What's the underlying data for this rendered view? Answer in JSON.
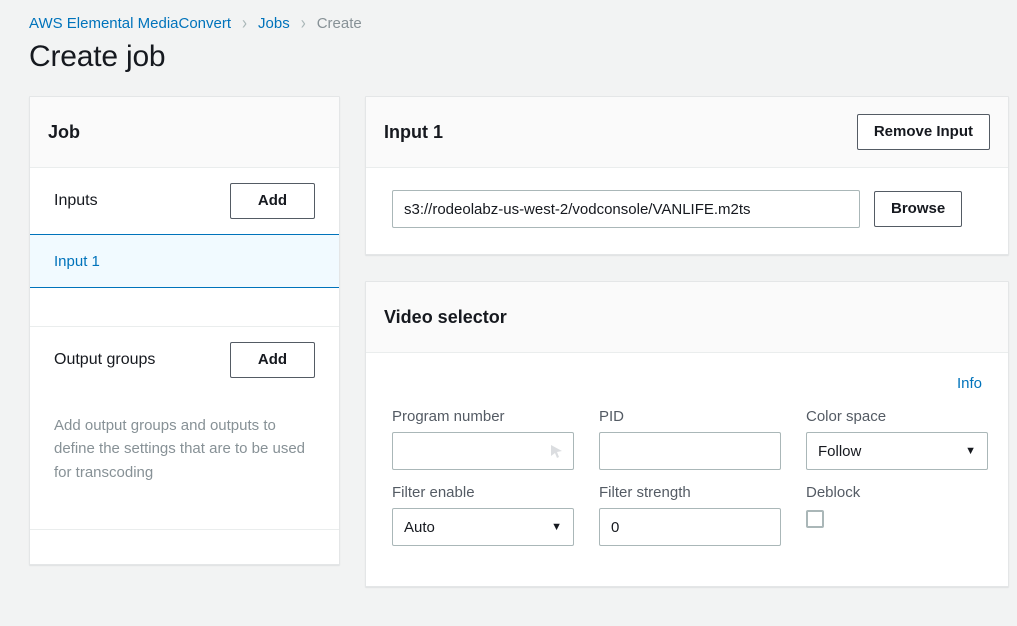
{
  "breadcrumb": {
    "items": [
      {
        "label": "AWS Elemental MediaConvert",
        "type": "link"
      },
      {
        "label": "Jobs",
        "type": "link"
      },
      {
        "label": "Create",
        "type": "current"
      }
    ],
    "separator": "›"
  },
  "page": {
    "title": "Create job"
  },
  "colors": {
    "link": "#0073bb",
    "page_background": "#f2f3f3",
    "panel_header_background": "#fafafa",
    "selected_item_background": "#f1faff",
    "muted_text": "#879196",
    "label_text": "#545b64"
  },
  "sidebar": {
    "title": "Job",
    "inputs": {
      "label": "Inputs",
      "add_label": "Add",
      "items": [
        {
          "label": "Input 1",
          "selected": true
        }
      ]
    },
    "output_groups": {
      "label": "Output groups",
      "add_label": "Add",
      "empty_text": "Add output groups and outputs to define the settings that are to be used for transcoding"
    }
  },
  "input_panel": {
    "title": "Input 1",
    "remove_label": "Remove Input",
    "file_input": {
      "value": "s3://rodeolabz-us-west-2/vodconsole/VANLIFE.m2ts",
      "placeholder": "s3://bucket/path"
    },
    "browse_label": "Browse"
  },
  "video_selector": {
    "title": "Video selector",
    "info_label": "Info",
    "fields": [
      {
        "name": "program-number",
        "label": "Program number",
        "kind": "text",
        "value": "",
        "placeholder": ""
      },
      {
        "name": "pid",
        "label": "PID",
        "kind": "text",
        "value": "",
        "placeholder": ""
      },
      {
        "name": "color-space",
        "label": "Color space",
        "kind": "select",
        "value": "Follow",
        "caret": "▼"
      },
      {
        "name": "filter-enable",
        "label": "Filter enable",
        "kind": "select",
        "value": "Auto",
        "caret": "▼"
      },
      {
        "name": "filter-strength",
        "label": "Filter strength",
        "kind": "text",
        "value": "0",
        "placeholder": ""
      },
      {
        "name": "deblock",
        "label": "Deblock",
        "kind": "checkbox",
        "checked": false
      }
    ]
  }
}
